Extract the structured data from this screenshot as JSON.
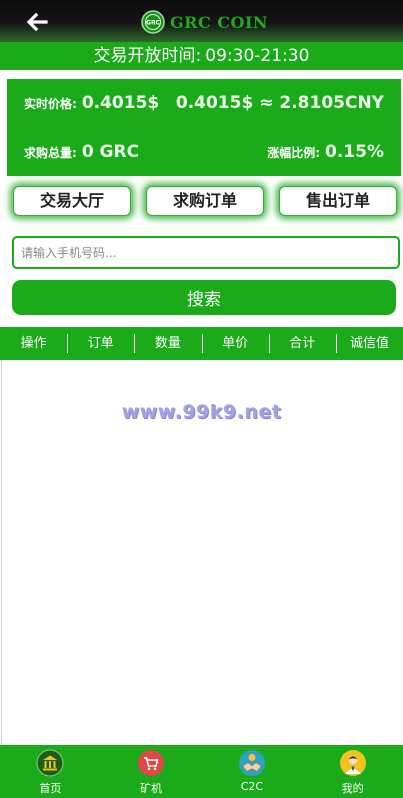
{
  "header": {
    "back_icon": "arrow-left-icon",
    "logo_text": "GRC COIN",
    "logo_badge": "GRC"
  },
  "trading_hours": {
    "label": "交易开放时间:",
    "time": "09:30-21:30"
  },
  "stats": {
    "realtime_price_label": "实时价格:",
    "realtime_price_value": "0.4015$",
    "conversion": "0.4015$ ≈ 2.8105CNY",
    "purchase_total_label": "求购总量:",
    "purchase_total_value": "0 GRC",
    "change_ratio_label": "涨幅比例:",
    "change_ratio_value": "0.15%"
  },
  "tabs": [
    {
      "label": "交易大厅"
    },
    {
      "label": "求购订单"
    },
    {
      "label": "售出订单"
    }
  ],
  "search": {
    "placeholder": "请输入手机号码...",
    "value": "",
    "button_label": "搜索"
  },
  "table": {
    "columns": [
      "操作",
      "订单",
      "数量",
      "单价",
      "合计",
      "诚信值"
    ],
    "rows": []
  },
  "watermark": "www.99k9.net",
  "bottom_nav": [
    {
      "label": "首页",
      "icon": "bank-icon"
    },
    {
      "label": "矿机",
      "icon": "shopping-cart-icon"
    },
    {
      "label": "C2C",
      "icon": "handshake-icon"
    },
    {
      "label": "我的",
      "icon": "user-avatar-icon"
    }
  ],
  "colors": {
    "primary_green": "#1aaa1a",
    "header_dark": "#111111",
    "watermark": "#a2a2e6"
  }
}
